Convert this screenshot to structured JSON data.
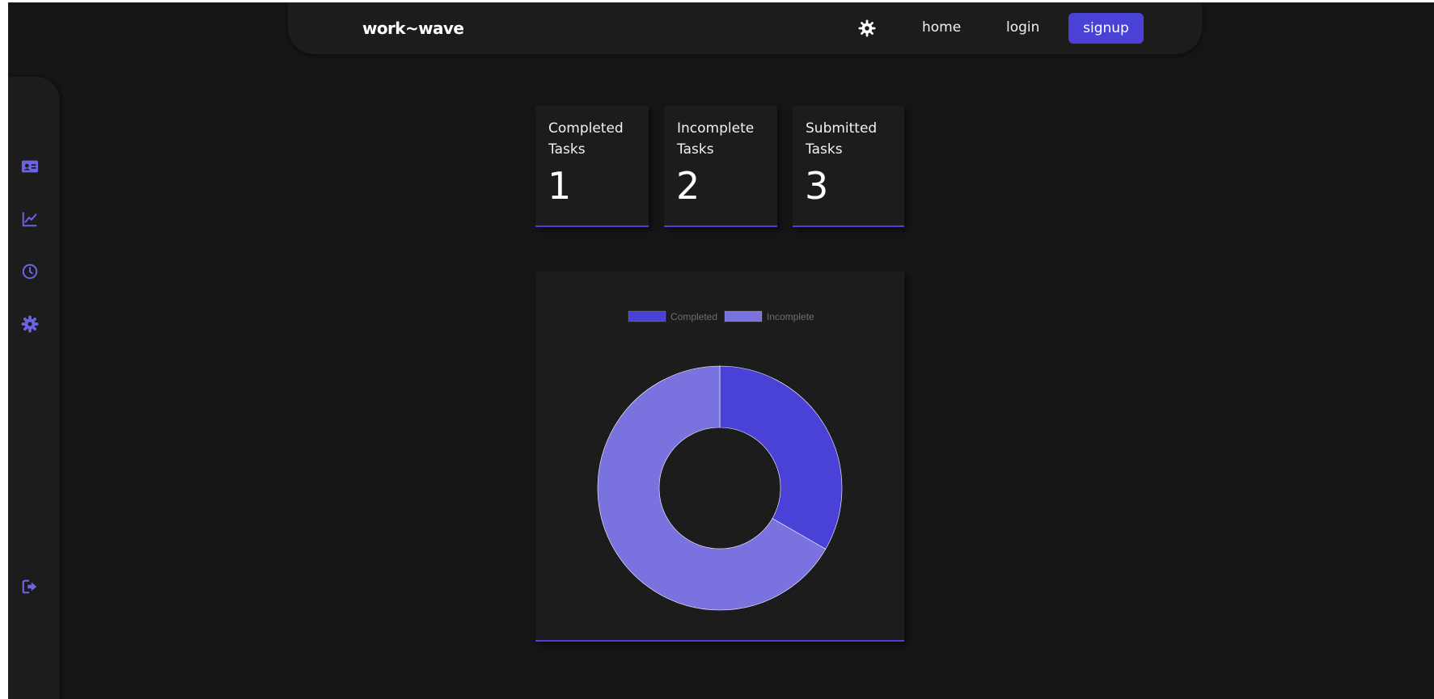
{
  "navbar": {
    "brand": "work~wave",
    "theme_icon": "gear-icon",
    "links": {
      "home": "home",
      "login": "login"
    },
    "signup_label": "signup"
  },
  "sidebar": {
    "icons": [
      "id-card-icon",
      "line-chart-icon",
      "clock-icon",
      "gear-icon"
    ],
    "logout_icon": "logout-icon"
  },
  "stats": [
    {
      "label": "Completed Tasks",
      "value": "1"
    },
    {
      "label": "Incomplete Tasks",
      "value": "2"
    },
    {
      "label": "Submitted Tasks",
      "value": "3"
    }
  ],
  "chart_data": {
    "type": "pie",
    "variant": "doughnut",
    "categories": [
      "Completed",
      "Incomplete"
    ],
    "values": [
      1,
      2
    ],
    "colors": [
      "#4a42d6",
      "#7a73df"
    ],
    "legend": "top"
  },
  "colors": {
    "accent": "#4a42d6",
    "background": "#161616",
    "surface": "#1c1c1c"
  }
}
